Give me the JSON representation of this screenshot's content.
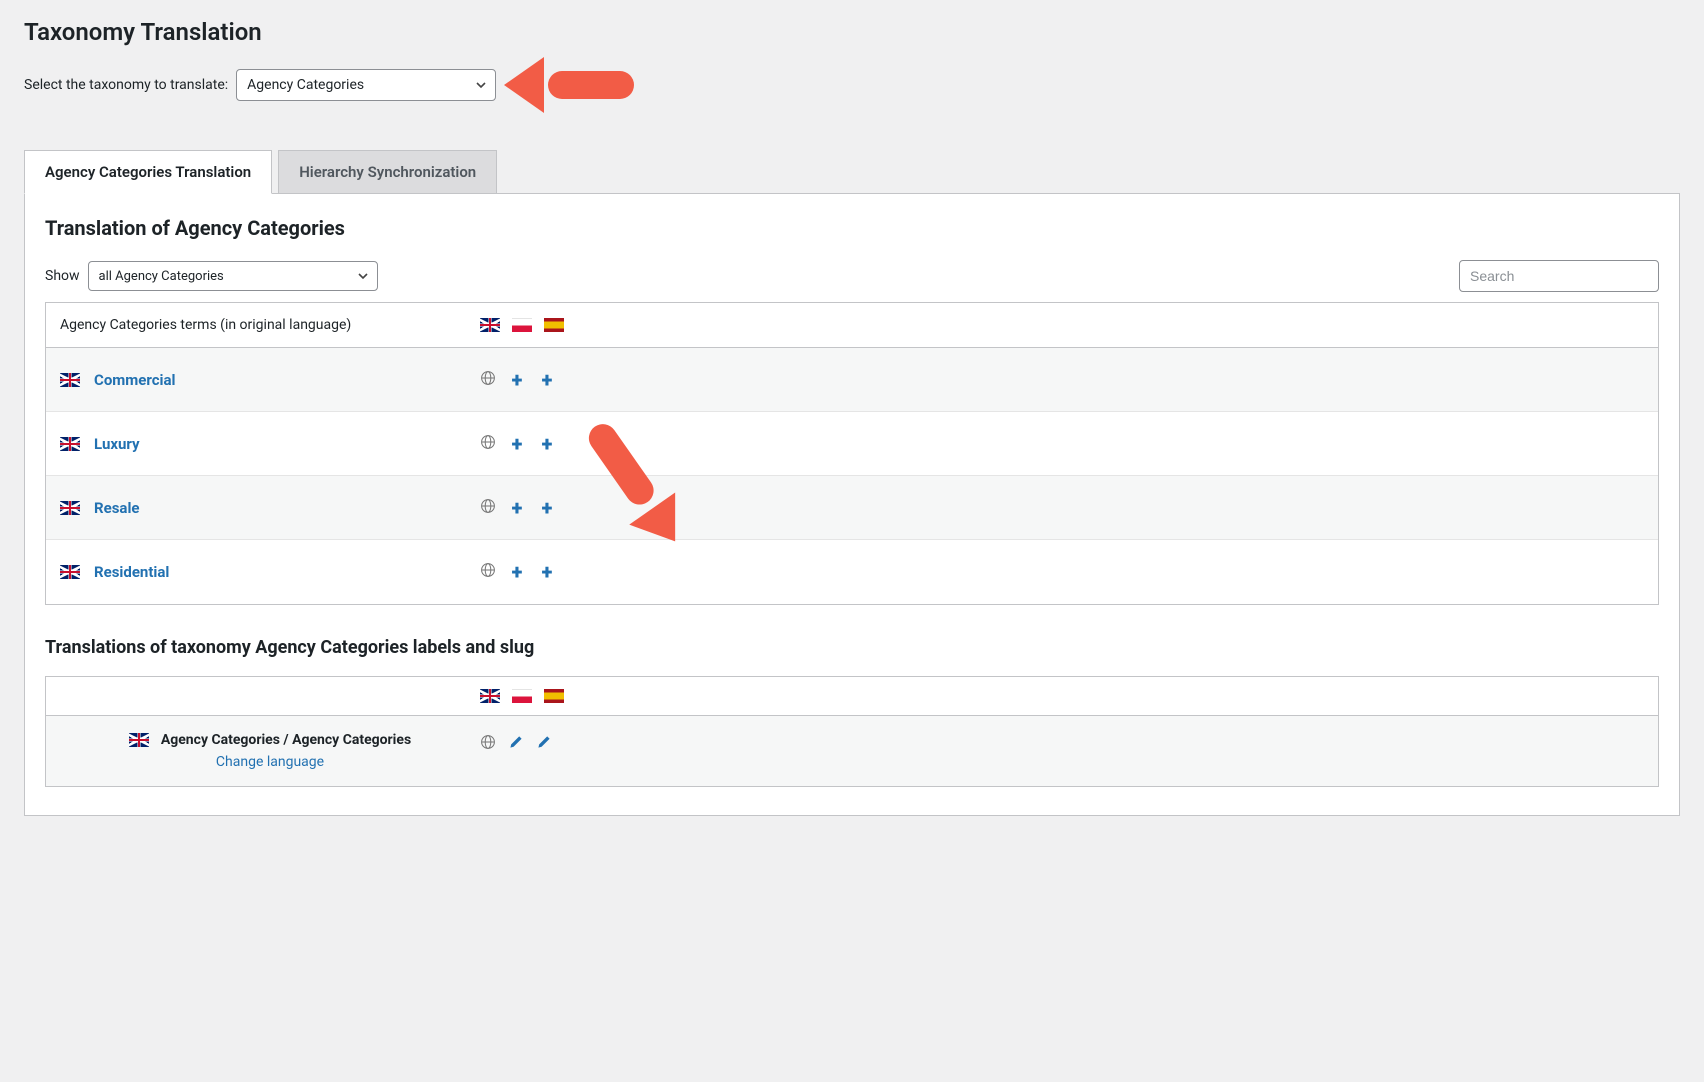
{
  "page": {
    "title": "Taxonomy Translation",
    "selector_label": "Select the taxonomy to translate:",
    "selector_value": "Agency Categories"
  },
  "tabs": [
    {
      "label": "Agency Categories Translation",
      "active": true
    },
    {
      "label": "Hierarchy Synchronization",
      "active": false
    }
  ],
  "section1": {
    "heading": "Translation of Agency Categories",
    "show_label": "Show",
    "show_value": "all Agency Categories",
    "search_placeholder": "Search",
    "header_col": "Agency Categories terms (in original language)"
  },
  "flags_header": [
    "uk",
    "pl",
    "es"
  ],
  "terms": [
    {
      "label": "Commercial",
      "flag": "uk",
      "actions": [
        "globe",
        "plus",
        "plus"
      ]
    },
    {
      "label": "Luxury",
      "flag": "uk",
      "actions": [
        "globe",
        "plus",
        "plus"
      ]
    },
    {
      "label": "Resale",
      "flag": "uk",
      "actions": [
        "globe",
        "plus",
        "plus"
      ]
    },
    {
      "label": "Residential",
      "flag": "uk",
      "actions": [
        "globe",
        "plus",
        "plus"
      ]
    }
  ],
  "section2": {
    "heading": "Translations of taxonomy Agency Categories labels and slug",
    "slug_label": "Agency Categories / Agency Categories",
    "change_language": "Change language",
    "actions": [
      "globe",
      "pencil",
      "pencil"
    ]
  },
  "icons": {
    "globe": "globe-icon",
    "plus": "plus-icon",
    "pencil": "pencil-icon"
  }
}
